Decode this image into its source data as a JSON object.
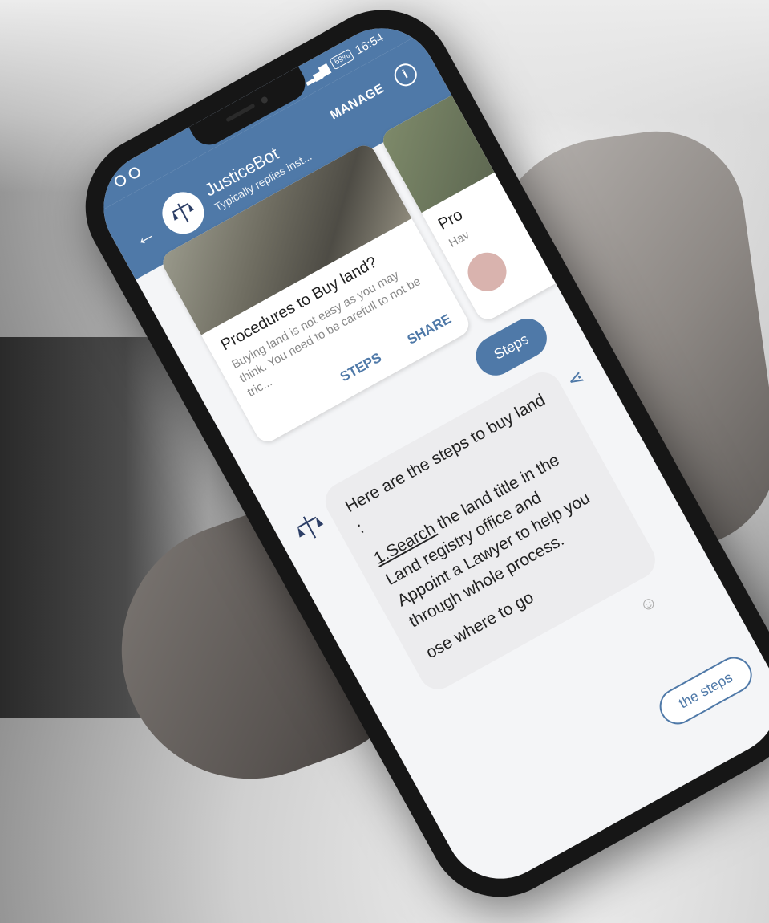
{
  "status_bar": {
    "time": "16:54",
    "battery": "69%"
  },
  "app_bar": {
    "title": "JusticeBot",
    "subtitle": "Typically replies inst...",
    "manage_label": "MANAGE",
    "back_icon": "arrow-left-icon",
    "info_icon": "info-icon"
  },
  "cards": [
    {
      "title": "Procedures to Buy land?",
      "description": "Buying land is not easy as you may think. You need to be carefull to not be tric...",
      "actions": [
        "STEPS",
        "SHARE"
      ]
    },
    {
      "title": "Pro",
      "description": "Hav"
    }
  ],
  "messages": {
    "user_reply": "Steps",
    "bot_intro": "Here are the steps to buy land :",
    "step1_link": "1.Search",
    "step1_text": " the land title in the Land registry office and Appoint a Lawyer to help you through whole process.",
    "step2_partial": "ose where to go",
    "chip_label": "the steps"
  },
  "colors": {
    "primary": "#4f79a8",
    "bubble_bot": "#ececee"
  }
}
